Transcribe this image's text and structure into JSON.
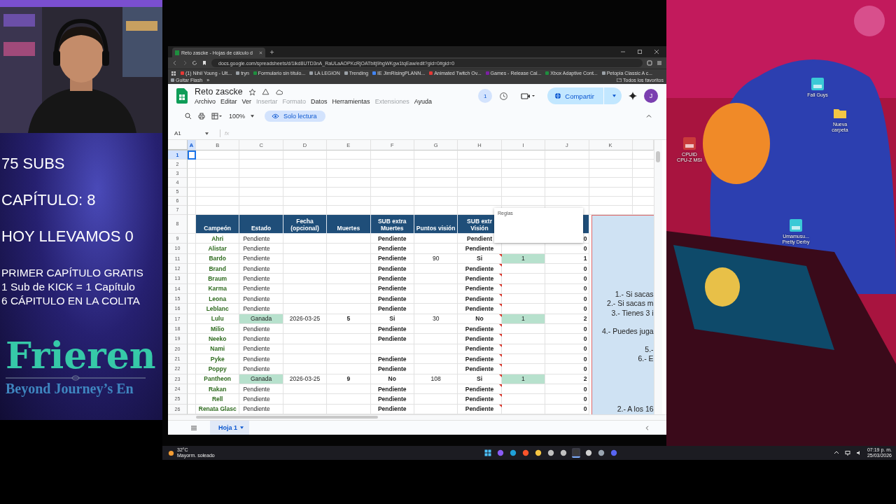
{
  "stream_overlay": {
    "stats": [
      "75 SUBS",
      "CAPÍTULO: 8",
      "HOY LLEVAMOS 0"
    ],
    "notes": [
      "PRIMER CAPÍTULO GRATIS",
      "1 Sub de KICK = 1 Capítulo",
      "6 CÁPITULO EN LA COLITA"
    ],
    "logo": {
      "title": "Frieren",
      "subtitle": "Beyond Journey’s En"
    }
  },
  "browser": {
    "tab": {
      "title": "Reto zascke - Hojas de cálculo d"
    },
    "url": "docs.google.com/spreadsheets/d/1ikd8UTD3nA_RaULaAOPKcRjOATbitj9hgWKgw1tqEaw/edit?gid=0#gid=0",
    "bookmarks": [
      {
        "label": "(1) Nihil Young - Ult...",
        "kind": "video"
      },
      {
        "label": "tryn",
        "kind": "link"
      },
      {
        "label": "Formulario sin título...",
        "kind": "sheet"
      },
      {
        "label": "LA LEGION",
        "kind": "link"
      },
      {
        "label": "Trending",
        "kind": "link"
      },
      {
        "label": "IE JimRisingPLANN...",
        "kind": "doc"
      },
      {
        "label": "Animated Twitch Ov...",
        "kind": "video"
      },
      {
        "label": "Games - Release Cal...",
        "kind": "game"
      },
      {
        "label": "Xbox Adaptive Cont...",
        "kind": "sheet"
      },
      {
        "label": "Petopia Classic A c...",
        "kind": "link"
      },
      {
        "label": "Guitar Flash",
        "kind": "link"
      }
    ],
    "more": "»",
    "all_bookmarks": "Todos los favoritos"
  },
  "sheet": {
    "title": "Reto zascke",
    "menus": [
      {
        "label": "Archivo",
        "disabled": false
      },
      {
        "label": "Editar",
        "disabled": false
      },
      {
        "label": "Ver",
        "disabled": false
      },
      {
        "label": "Insertar",
        "disabled": true
      },
      {
        "label": "Formato",
        "disabled": true
      },
      {
        "label": "Datos",
        "disabled": false
      },
      {
        "label": "Herramientas",
        "disabled": false
      },
      {
        "label": "Extensiones",
        "disabled": true
      },
      {
        "label": "Ayuda",
        "disabled": false
      }
    ],
    "viewers": "1",
    "share": "Compartir",
    "avatar": "J",
    "zoom": "100%",
    "mode": "Solo lectura",
    "cell_ref": "A1",
    "formula_icon": "fx",
    "columns": [
      {
        "letter": "A",
        "selected": true
      },
      {
        "letter": "B",
        "selected": false
      },
      {
        "letter": "C",
        "selected": false
      },
      {
        "letter": "D",
        "selected": false
      },
      {
        "letter": "E",
        "selected": false
      },
      {
        "letter": "F",
        "selected": false
      },
      {
        "letter": "G",
        "selected": false
      },
      {
        "letter": "H",
        "selected": false
      },
      {
        "letter": "I",
        "selected": false
      },
      {
        "letter": "J",
        "selected": false
      },
      {
        "letter": "K",
        "selected": false
      }
    ],
    "blank_rows": [
      {
        "num": "1",
        "selected": true
      },
      {
        "num": "2",
        "selected": false
      },
      {
        "num": "3",
        "selected": false
      },
      {
        "num": "4",
        "selected": false
      },
      {
        "num": "5",
        "selected": false
      },
      {
        "num": "6",
        "selected": false
      },
      {
        "num": "7",
        "selected": false
      }
    ],
    "header_row": {
      "num": "8",
      "cells": [
        "Campeón",
        "Estado",
        "Fecha\n(opcional)",
        "Muertes",
        "SUB extra\nMuertes",
        "Puntos visión",
        "SUB extr\nVisión"
      ]
    },
    "rows": [
      {
        "num": "9",
        "champion": "Ahri",
        "status": "Pendiente",
        "won": false,
        "sub_deaths": "Pendiente",
        "sub_vision": "Pendient",
        "total": "0"
      },
      {
        "num": "10",
        "champion": "Alistar",
        "status": "Pendiente",
        "won": false,
        "sub_deaths": "Pendiente",
        "sub_vision": "Pendiente",
        "total": "0"
      },
      {
        "num": "11",
        "champion": "Bardo",
        "status": "Pendiente",
        "won": false,
        "sub_deaths": "Pendiente",
        "vision": "90",
        "sub_vision": "Si",
        "note": true,
        "bonus": "1",
        "bonus_hl": true,
        "total": "1"
      },
      {
        "num": "12",
        "champion": "Brand",
        "status": "Pendiente",
        "won": false,
        "sub_deaths": "Pendiente",
        "sub_vision": "Pendiente",
        "note": true,
        "bonus_hl": false,
        "total": "0"
      },
      {
        "num": "13",
        "champion": "Braum",
        "status": "Pendiente",
        "won": false,
        "sub_deaths": "Pendiente",
        "sub_vision": "Pendiente",
        "note": true,
        "bonus_hl": false,
        "total": "0"
      },
      {
        "num": "14",
        "champion": "Karma",
        "status": "Pendiente",
        "won": false,
        "sub_deaths": "Pendiente",
        "sub_vision": "Pendiente",
        "note": true,
        "bonus_hl": false,
        "total": "0"
      },
      {
        "num": "15",
        "champion": "Leona",
        "status": "Pendiente",
        "won": false,
        "sub_deaths": "Pendiente",
        "sub_vision": "Pendiente",
        "note": true,
        "bonus_hl": false,
        "total": "0"
      },
      {
        "num": "16",
        "champion": "Leblanc",
        "status": "Pendiente",
        "won": false,
        "sub_deaths": "Pendiente",
        "sub_vision": "Pendiente",
        "note": true,
        "bonus_hl": false,
        "total": "0"
      },
      {
        "num": "17",
        "champion": "Lulu",
        "status": "Ganada",
        "won": true,
        "date": "2026-03-25",
        "deaths": "5",
        "sub_deaths": "Si",
        "vision": "30",
        "sub_vision": "No",
        "note": true,
        "bonus": "1",
        "bonus_hl": true,
        "total": "2"
      },
      {
        "num": "18",
        "champion": "Milio",
        "status": "Pendiente",
        "won": false,
        "sub_deaths": "Pendiente",
        "sub_vision": "Pendiente",
        "note": true,
        "bonus_hl": false,
        "total": "0"
      },
      {
        "num": "19",
        "champion": "Neeko",
        "status": "Pendiente",
        "won": false,
        "sub_deaths": "Pendiente",
        "sub_vision": "Pendiente",
        "note": true,
        "bonus_hl": false,
        "total": "0"
      },
      {
        "num": "20",
        "champion": "Nami",
        "status": "Pendiente",
        "won": false,
        "sub_vision": "Pendiente",
        "note": true,
        "bonus_hl": false,
        "total": "0"
      },
      {
        "num": "21",
        "champion": "Pyke",
        "status": "Pendiente",
        "won": false,
        "sub_deaths": "Pendiente",
        "sub_vision": "Pendiente",
        "note": true,
        "bonus_hl": false,
        "total": "0"
      },
      {
        "num": "22",
        "champion": "Poppy",
        "status": "Pendiente",
        "won": false,
        "sub_deaths": "Pendiente",
        "sub_vision": "Pendiente",
        "note": true,
        "bonus_hl": false,
        "total": "0"
      },
      {
        "num": "23",
        "champion": "Pantheon",
        "status": "Ganada",
        "won": true,
        "date": "2026-03-25",
        "deaths": "9",
        "sub_deaths": "No",
        "vision": "108",
        "sub_vision": "Si",
        "note": true,
        "bonus": "1",
        "bonus_hl": true,
        "total": "2"
      },
      {
        "num": "24",
        "champion": "Rakan",
        "status": "Pendiente",
        "won": false,
        "sub_deaths": "Pendiente",
        "sub_vision": "Pendiente",
        "note": true,
        "bonus_hl": false,
        "total": "0"
      },
      {
        "num": "25",
        "champion": "Rell",
        "status": "Pendiente",
        "won": false,
        "sub_deaths": "Pendiente",
        "sub_vision": "Pendiente",
        "note": true,
        "bonus_hl": false,
        "total": "0"
      },
      {
        "num": "26",
        "champion": "Renata Glasc",
        "status": "Pendiente",
        "won": false,
        "sub_deaths": "Pendiente",
        "sub_vision": "Pendiente",
        "note": true,
        "bonus_hl": false,
        "total": "0"
      }
    ],
    "note_popup": {
      "title": "Reglas"
    },
    "rules": [
      {
        "lines": [
          "1.- Si sacas",
          "2.- Si sacas m",
          "3.- Tienes 3 i"
        ]
      },
      {
        "lines": [
          "4.- Puedes juga"
        ]
      },
      {
        "lines": [
          "5.-",
          "6.- E"
        ]
      },
      {
        "lines": [
          "2.- A los 16"
        ]
      }
    ],
    "sheet_tab": {
      "label": "Hoja 1",
      "selected": true
    }
  },
  "desktop": {
    "icons": [
      {
        "kind": "game",
        "label": "Fall Guys"
      },
      {
        "kind": "folder",
        "label": "Nueva\ncarpeta"
      },
      {
        "kind": "app",
        "label": "CPUID\nCPU-Z MSI"
      },
      {
        "kind": "game",
        "label": "Umamusu...\nPretty Derby"
      }
    ]
  },
  "taskbar": {
    "temperature": "32°C",
    "weather": "Mayorm. soleado",
    "apps": [
      {
        "kind": "start",
        "active": false
      },
      {
        "kind": "widget",
        "active": false
      },
      {
        "kind": "edge",
        "active": false
      },
      {
        "kind": "brave",
        "active": false
      },
      {
        "kind": "folder",
        "active": false
      },
      {
        "kind": "app",
        "active": false
      },
      {
        "kind": "app",
        "active": false
      },
      {
        "kind": "terminal",
        "active": true
      },
      {
        "kind": "obs",
        "active": false
      },
      {
        "kind": "settings",
        "active": false
      },
      {
        "kind": "discord",
        "active": false
      }
    ],
    "time": "07:19 p. m.",
    "date": "25/03/2026"
  }
}
